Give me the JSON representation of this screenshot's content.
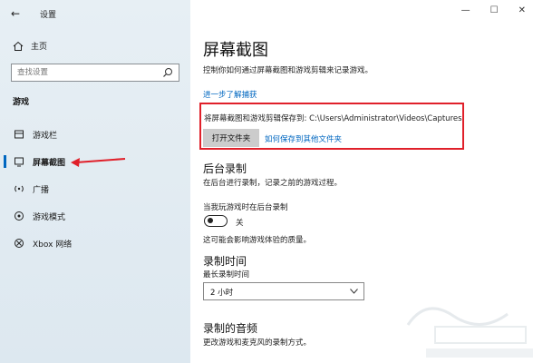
{
  "window": {
    "app_title": "设置",
    "controls": {
      "minimize": "—",
      "maximize": "☐",
      "close": "✕"
    }
  },
  "sidebar": {
    "home_label": "主页",
    "search_placeholder": "查找设置",
    "section_label": "游戏",
    "items": [
      {
        "label": "游戏栏",
        "icon": "game-bar-icon"
      },
      {
        "label": "屏幕截图",
        "icon": "capture-icon",
        "active": true
      },
      {
        "label": "广播",
        "icon": "broadcast-icon"
      },
      {
        "label": "游戏模式",
        "icon": "game-mode-icon"
      },
      {
        "label": "Xbox 网络",
        "icon": "xbox-icon"
      }
    ]
  },
  "main": {
    "title": "屏幕截图",
    "description": "控制你如何通过屏幕截图和游戏剪辑来记录游戏。",
    "learn_more": "进一步了解捕获",
    "save_location_text": "将屏幕截图和游戏剪辑保存到: C:\\Users\\Administrator\\Videos\\Captures",
    "open_folder_button": "打开文件夹",
    "save_elsewhere_link": "如何保存到其他文件夹",
    "background_recording": {
      "heading": "后台录制",
      "description": "在后台进行录制，记录之前的游戏过程。",
      "toggle_caption": "当我玩游戏时在后台录制",
      "toggle_state": "关",
      "note": "这可能会影响游戏体验的质量。"
    },
    "recording_time": {
      "heading": "录制时间",
      "max_label": "最长录制时间",
      "selected": "2 小时"
    },
    "audio": {
      "heading": "录制的音频",
      "description": "更改游戏和麦克风的录制方式。"
    }
  },
  "colors": {
    "accent": "#0067c0",
    "highlight": "#e0202a"
  }
}
